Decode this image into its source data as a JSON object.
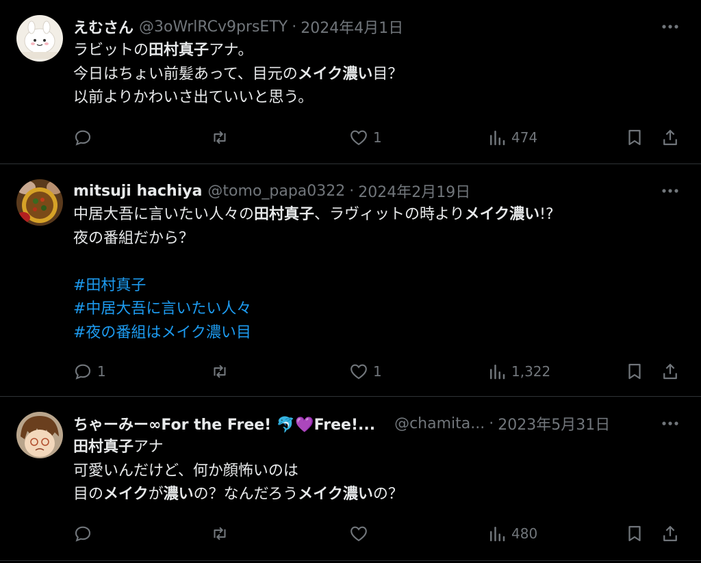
{
  "tweets": [
    {
      "name": "えむさん",
      "handle": "@3oWrlRCv9prsETY",
      "date": "2024年4月1日",
      "lines": [
        [
          "ラビットの",
          "田村真子",
          "アナ。"
        ],
        [
          "今日はちょい前髪あって、目元の",
          "メイク濃い",
          "目？"
        ],
        [
          "以前よりかわいさ出ていいと思う。"
        ]
      ],
      "actions": {
        "reply": "",
        "retweet": "",
        "like": "1",
        "views": "474"
      }
    },
    {
      "name": "mitsuji hachiya",
      "handle": "@tomo_papa0322",
      "date": "2024年2月19日",
      "lines": [
        [
          "中居大吾に言いたい人々の",
          "田村真子",
          "、ラヴィットの時より",
          "メイク濃い",
          "!?"
        ],
        [
          "夜の番組だから？"
        ]
      ],
      "hashtags": [
        "#田村真子",
        "#中居大吾に言いたい人々",
        "#夜の番組はメイク濃い目"
      ],
      "actions": {
        "reply": "1",
        "retweet": "",
        "like": "1",
        "views": "1,322"
      }
    },
    {
      "name": "ちゃーみー∞For the Free! 🐬💜Free!...",
      "handle": "@chamita...",
      "date": "2023年5月31日",
      "lines": [
        [
          "田村真子",
          "アナ"
        ],
        [
          "可愛いんだけど、何か顔怖いのは"
        ],
        [
          "目の",
          "メイク",
          "が",
          "濃い",
          "の？なんだろう",
          "メイク濃い",
          "の？"
        ]
      ],
      "actions": {
        "reply": "",
        "retweet": "",
        "like": "",
        "views": "480"
      }
    }
  ]
}
